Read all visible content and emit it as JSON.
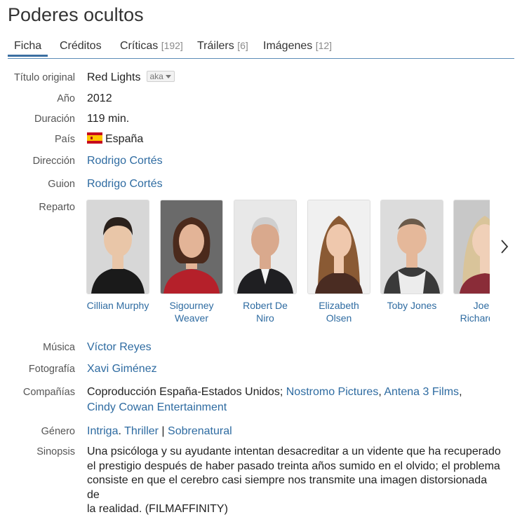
{
  "title": "Poderes ocultos",
  "tabs": [
    {
      "label": "Ficha",
      "count": ""
    },
    {
      "label": "Créditos",
      "count": ""
    },
    {
      "label": "Críticas",
      "count": "[192]"
    },
    {
      "label": "Tráilers",
      "count": "[6]"
    },
    {
      "label": "Imágenes",
      "count": "[12]"
    }
  ],
  "fields": {
    "original_title": {
      "label": "Título original",
      "value": "Red Lights",
      "aka": "aka"
    },
    "year": {
      "label": "Año",
      "value": "2012"
    },
    "duration": {
      "label": "Duración",
      "value": "119 min."
    },
    "country": {
      "label": "País",
      "value": "España"
    },
    "director": {
      "label": "Dirección",
      "value": "Rodrigo Cortés"
    },
    "writer": {
      "label": "Guion",
      "value": "Rodrigo Cortés"
    },
    "cast_label": "Reparto",
    "music": {
      "label": "Música",
      "value": "Víctor Reyes"
    },
    "photography": {
      "label": "Fotografía",
      "value": "Xavi Giménez"
    },
    "companies": {
      "label": "Compañías",
      "prefix": "Coproducción España-Estados Unidos;",
      "c1": "Nostromo Pictures",
      "c2": "Antena 3 Films",
      "c3": "Cindy Cowan Entertainment",
      "comma": ","
    },
    "genre": {
      "label": "Género",
      "g1": "Intriga",
      "dot": ".",
      "g2": "Thriller",
      "bar": "|",
      "g3": "Sobrenatural"
    },
    "synopsis": {
      "label": "Sinopsis",
      "line1": "Una psicóloga y su ayudante intentan desacreditar a un vidente que ha recuperado",
      "line2": "el prestigio después de haber pasado treinta años sumido en el olvido; el problema",
      "line3": "consiste en que el cerebro casi siempre nos transmite una imagen distorsionada de",
      "line4": "la realidad. (FILMAFFINITY)"
    }
  },
  "cast": [
    {
      "name1": "Cillian Murphy",
      "name2": "",
      "bg": "#d7d7d7",
      "skin": "#e9c6a8",
      "hair": "#2a211c",
      "shirt": "#1a1a1a"
    },
    {
      "name1": "Sigourney",
      "name2": "Weaver",
      "bg": "#6a6a6a",
      "skin": "#e3b497",
      "hair": "#4b2a1c",
      "shirt": "#b5202a"
    },
    {
      "name1": "Robert De Niro",
      "name2": "",
      "bg": "#e8e8e8",
      "skin": "#d9a98d",
      "hair": "#cfcfcf",
      "shirt": "#1f1f22"
    },
    {
      "name1": "Elizabeth",
      "name2": "Olsen",
      "bg": "#f0f0f0",
      "skin": "#efc8ad",
      "hair": "#8a5a34",
      "shirt": "#4a2c22"
    },
    {
      "name1": "Toby Jones",
      "name2": "",
      "bg": "#dcdcdc",
      "skin": "#e5b89a",
      "hair": "#6b5a4a",
      "shirt": "#3a3a3a"
    },
    {
      "name1": "Joely",
      "name2": "Richardson",
      "bg": "#c8c8c8",
      "skin": "#f0d0b8",
      "hair": "#d9c49a",
      "shirt": "#8a2c38"
    }
  ],
  "colors": {
    "link": "#2e6ba1",
    "tab_underline": "#3b6fa2",
    "label": "#555555"
  }
}
